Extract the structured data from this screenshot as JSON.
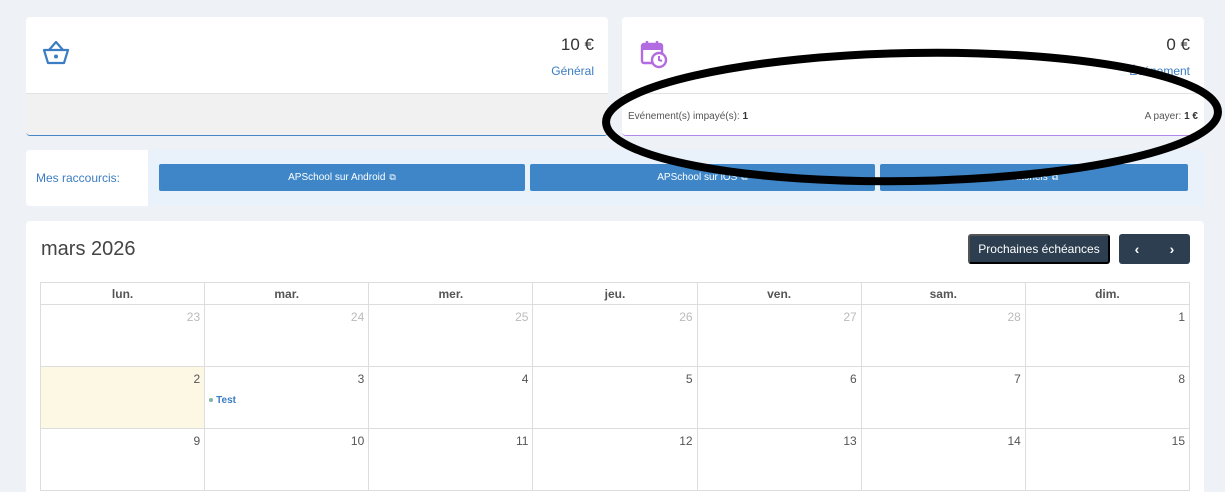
{
  "cards": {
    "general": {
      "amount": "10 €",
      "label": "Général",
      "icon": "basket-icon"
    },
    "event": {
      "amount": "0 €",
      "label": "Événement",
      "icon": "calendar-clock-icon",
      "unpaid_label": "Evénement(s) impayé(s): ",
      "unpaid_count": "1",
      "to_pay_label": "A payer: ",
      "to_pay_amount": "1 €"
    }
  },
  "shortcuts": {
    "label": "Mes raccourcis:",
    "buttons": [
      {
        "label": "APSchool sur Android"
      },
      {
        "label": "APSchool sur iOS"
      },
      {
        "label": "Tutoriels"
      }
    ]
  },
  "calendar": {
    "title": "mars 2026",
    "next_due_label": "Prochaines échéances",
    "weekdays": [
      "lun.",
      "mar.",
      "mer.",
      "jeu.",
      "ven.",
      "sam.",
      "dim."
    ],
    "weeks": [
      [
        "23",
        "24",
        "25",
        "26",
        "27",
        "28",
        "1"
      ],
      [
        "2",
        "3",
        "4",
        "5",
        "6",
        "7",
        "8"
      ],
      [
        "9",
        "10",
        "11",
        "12",
        "13",
        "14",
        "15"
      ]
    ],
    "event_label": "Test"
  },
  "colors": {
    "accent": "#3e86c8",
    "event_accent": "#b388eb",
    "dark_button": "#2c3e50",
    "today_highlight": "#fcf8e3"
  }
}
